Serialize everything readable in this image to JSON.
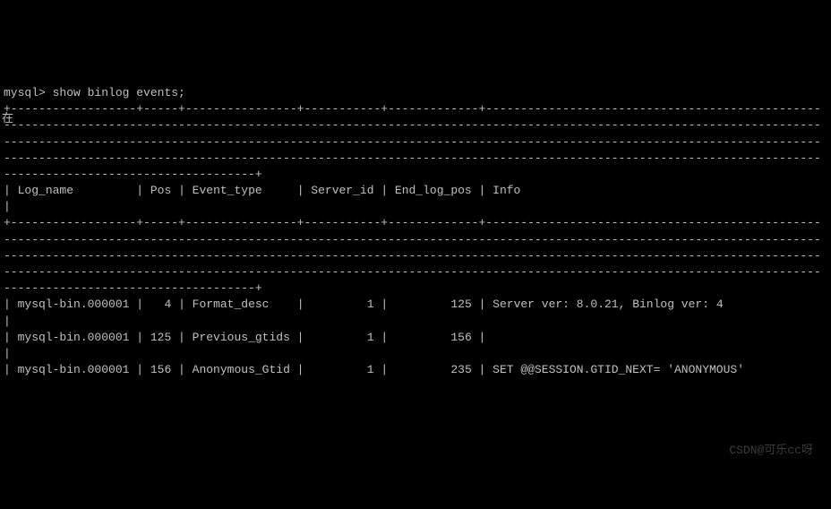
{
  "prompt": "mysql>",
  "command": "show binlog events;",
  "left_marker": "在",
  "border_top": "+------------------+-----+----------------+-----------+-------------+---------------------------------------------------------------------------------------------------------------------------------------------------------------------------------------------------------------------------------------------------------------------------------------------------------------------------------------------------------------------------------------------------------------------------------------------------+",
  "header": {
    "log_name": "Log_name",
    "pos": "Pos",
    "event_type": "Event_type",
    "server_id": "Server_id",
    "end_log_pos": "End_log_pos",
    "info": "Info"
  },
  "rows": [
    {
      "log_name": "mysql-bin.000001",
      "pos": "4",
      "event_type": "Format_desc",
      "server_id": "1",
      "end_log_pos": "125",
      "info": "Server ver: 8.0.21, Binlog ver: 4"
    },
    {
      "log_name": "mysql-bin.000001",
      "pos": "125",
      "event_type": "Previous_gtids",
      "server_id": "1",
      "end_log_pos": "156",
      "info": ""
    },
    {
      "log_name": "mysql-bin.000001",
      "pos": "156",
      "event_type": "Anonymous_Gtid",
      "server_id": "1",
      "end_log_pos": "235",
      "info": "SET @@SESSION.GTID_NEXT= 'ANONYMOUS'"
    }
  ],
  "watermark": "CSDN@可乐cc呀"
}
